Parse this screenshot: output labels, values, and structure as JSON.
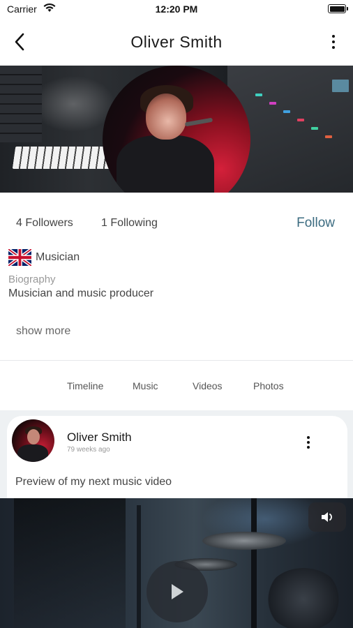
{
  "status_bar": {
    "carrier": "Carrier",
    "time": "12:20 PM"
  },
  "nav": {
    "title": "Oliver Smith",
    "back_icon": "chevron-left-icon",
    "more_icon": "more-vertical-icon"
  },
  "profile": {
    "followers": "4 Followers",
    "following": "1 Following",
    "follow_label": "Follow",
    "profession": "Musician",
    "flag_icon": "uk-flag-icon",
    "bio_label": "Biography",
    "bio_text": "Musician and music producer",
    "show_more": "show more"
  },
  "tabs": [
    {
      "label": "Timeline"
    },
    {
      "label": "Music"
    },
    {
      "label": "Videos"
    },
    {
      "label": "Photos"
    }
  ],
  "post": {
    "author": "Oliver Smith",
    "time": "79 weeks ago",
    "caption": "Preview of my next music video",
    "more_icon": "more-vertical-icon",
    "volume_icon": "volume-icon",
    "play_icon": "play-icon"
  },
  "colors": {
    "accent": "#3b6b80",
    "feed_background": "#eef1f3"
  }
}
